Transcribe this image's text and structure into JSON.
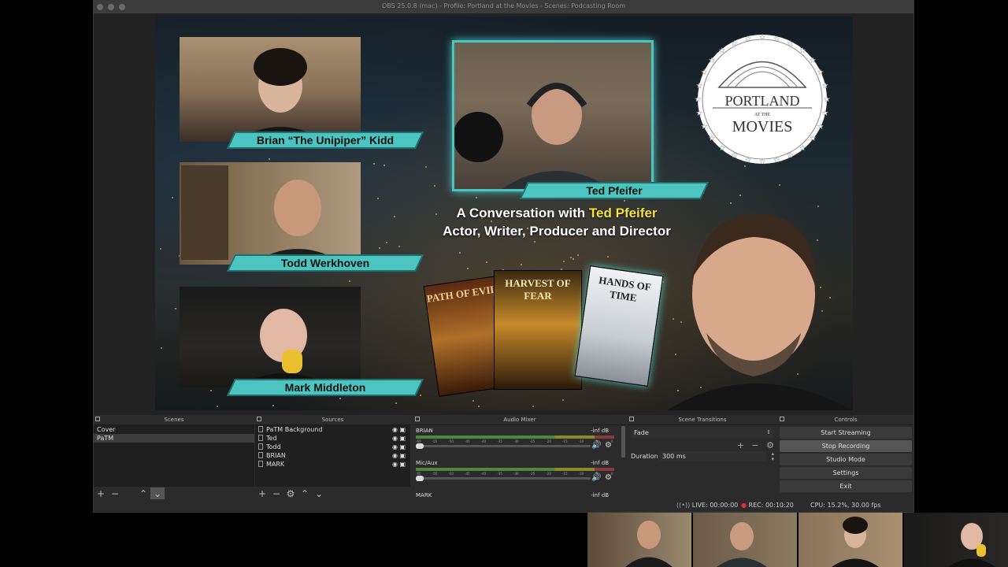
{
  "window": {
    "title": "OBS 25.0.8 (mac) - Profile: Portland at the Movies - Scenes: Podcasting Room"
  },
  "preview": {
    "participants": [
      {
        "name": "Brian “The Unipiper” Kidd"
      },
      {
        "name": "Ted Pfeifer"
      },
      {
        "name": "Todd Werkhoven"
      },
      {
        "name": "Mark Middleton"
      }
    ],
    "headline_line1_prefix": "A Conversation with ",
    "headline_line1_highlight": "Ted Pfeifer",
    "headline_line2": "Actor, Writer, Producer and Director",
    "logo_text_top": "PORTLAND",
    "logo_text_small": "AT THE",
    "logo_text_bottom": "MOVIES",
    "posters": [
      {
        "title": "PATH OF EVIL",
        "color": "#b0702a"
      },
      {
        "title": "HARVEST OF FEAR",
        "color": "#c88a2a"
      },
      {
        "title": "HANDS OF TIME",
        "color": "#d8dde0"
      }
    ],
    "accent_color": "#4cc4c0",
    "highlight_color": "#f4e23a"
  },
  "scenes": {
    "header": "Scenes",
    "items": [
      "Cover",
      "PaTM"
    ],
    "selected_index": 1
  },
  "sources": {
    "header": "Sources",
    "items": [
      "PaTM Background",
      "Ted",
      "Todd",
      "BRIAN",
      "MARK"
    ]
  },
  "mixer": {
    "header": "Audio Mixer",
    "channels": [
      {
        "name": "BRIAN",
        "db": "-inf dB",
        "level": 0.0
      },
      {
        "name": "Mic/Aux",
        "db": "-inf dB",
        "level": 0.0
      },
      {
        "name": "MARK",
        "db": "-inf dB",
        "level": 0.0
      }
    ],
    "ticks": [
      "-60",
      "-55",
      "-50",
      "-45",
      "-40",
      "-35",
      "-30",
      "-25",
      "-20",
      "-15",
      "-10",
      "-5",
      "0"
    ]
  },
  "transitions": {
    "header": "Scene Transitions",
    "selected": "Fade",
    "duration_label": "Duration",
    "duration_value": "300 ms"
  },
  "controls": {
    "header": "Controls",
    "buttons": [
      "Start Streaming",
      "Stop Recording",
      "Studio Mode",
      "Settings",
      "Exit"
    ],
    "active_index": 1
  },
  "status": {
    "live": "LIVE: 00:00:00",
    "rec": "REC: 00:10:20",
    "cpu": "CPU: 15.2%, 30.00 fps"
  }
}
